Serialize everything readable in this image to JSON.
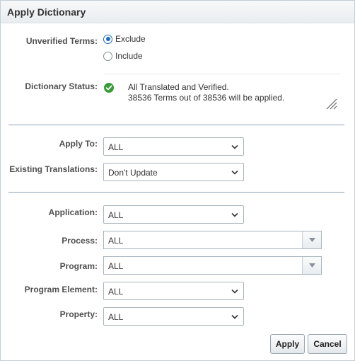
{
  "dialog": {
    "title": "Apply Dictionary"
  },
  "unverified_terms": {
    "label": "Unverified Terms:",
    "options": [
      {
        "label": "Exclude",
        "selected": true
      },
      {
        "label": "Include",
        "selected": false
      }
    ]
  },
  "dictionary_status": {
    "label": "Dictionary Status:",
    "icon": "check-circle-icon",
    "line1": "All Translated and Verified.",
    "line2": "38536 Terms out of 38536 will be applied."
  },
  "apply_to": {
    "label": "Apply To:",
    "value": "ALL"
  },
  "existing_translations": {
    "label": "Existing Translations:",
    "value": "Don't Update"
  },
  "application": {
    "label": "Application:",
    "value": "ALL"
  },
  "process": {
    "label": "Process:",
    "value": "ALL"
  },
  "program": {
    "label": "Program:",
    "value": "ALL"
  },
  "program_element": {
    "label": "Program Element:",
    "value": "ALL"
  },
  "property": {
    "label": "Property:",
    "value": "ALL"
  },
  "buttons": {
    "apply": "Apply",
    "cancel": "Cancel"
  },
  "colors": {
    "accent": "#1f6bb4",
    "success": "#3a9a3a",
    "divider": "#8fa5b7"
  }
}
